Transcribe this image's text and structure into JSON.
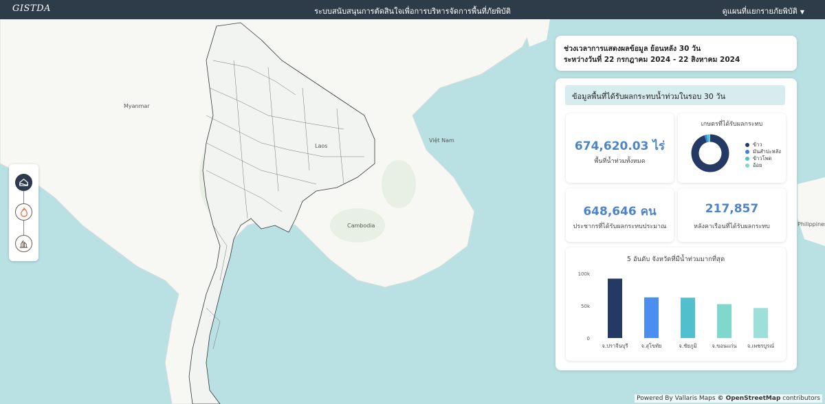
{
  "navbar": {
    "logo": "GISTDA",
    "title": "ระบบสนับสนุนการตัดสินใจเพื่อการบริหารจัดการพื้นที่ภัยพิบัติ",
    "menu_label": "ดูแผนที่แยกรายภัยพิบัติ"
  },
  "map": {
    "labels": {
      "myanmar": "Myanmar",
      "laos": "Laos",
      "vietnam": "Việt Nam",
      "cambodia": "Cambodia",
      "philippines": "Philippines"
    },
    "attribution_prefix": "Powered By Vallaris Maps",
    "attribution_osm": "© OpenStreetMap",
    "attribution_suffix": "contributors"
  },
  "tools": {
    "flood_icon": "flood-icon",
    "fire_icon": "fire-icon",
    "drought_icon": "drought-icon"
  },
  "date_range": {
    "line1": "ช่วงเวลาการแสดงผลข้อมูล ย้อนหลัง 30 วัน",
    "line2": "ระหว่างวันที่ 22 กรกฎาคม 2024 - 22 สิงหาคม 2024"
  },
  "summary": {
    "header": "ข้อมูลพื้นที่ได้รับผลกระทบน้ำท่วมในรอบ 30 วัน",
    "area_value": "674,620.03 ไร่",
    "area_label": "พื้นที่น้ำท่วมทั้งหมด",
    "population_value": "648,646 คน",
    "population_label": "ประชากรที่ได้รับผลกระทบประมาณ",
    "households_value": "217,857",
    "households_label": "หลังคาเรือนที่ได้รับผลกระทบ"
  },
  "colors": {
    "navbar": "#2e3c4a",
    "accent_blue": "#4c84c8",
    "header_bg": "#d7ecee",
    "sea": "#b9e1e3",
    "land": "#f7f7f4"
  },
  "chart_data": [
    {
      "type": "pie",
      "title": "เกษตรที่ได้รับผลกระทบ",
      "categories": [
        "ข้าว",
        "มันสำปะหลัง",
        "ข้าวโพด",
        "อ้อย"
      ],
      "values": [
        95,
        2,
        2.5,
        0.5
      ],
      "colors": [
        "#243a64",
        "#3f7fdc",
        "#52bfcf",
        "#7fd8cc"
      ],
      "legend": "right"
    },
    {
      "type": "bar",
      "title": "5 อันดับ จังหวัดที่มีน้ำท่วมมากที่สุด",
      "categories": [
        "จ.ปราจีนบุรี",
        "จ.สุโขทัย",
        "จ.ชัยภูมิ",
        "จ.ขอนแก่น",
        "จ.เพชรบูรณ์"
      ],
      "values": [
        92000,
        63000,
        62500,
        52500,
        46500
      ],
      "colors": [
        "#243a64",
        "#4b8ef0",
        "#52bfcf",
        "#7fd8cc",
        "#9ddfd9"
      ],
      "yticks": [
        "100k",
        "50k",
        "0"
      ],
      "ylim": [
        0,
        100000
      ],
      "grid": false
    }
  ]
}
